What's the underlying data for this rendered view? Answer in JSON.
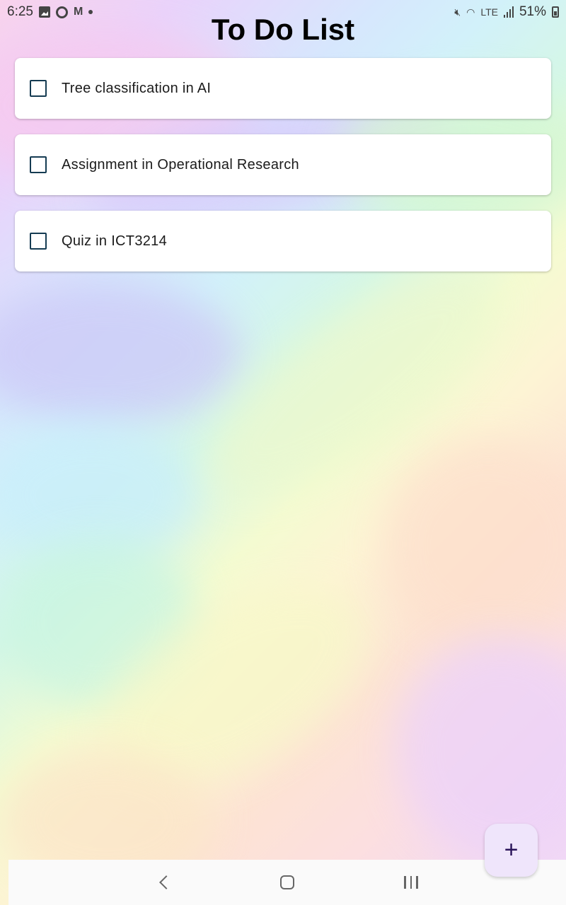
{
  "status_bar": {
    "time": "6:25",
    "battery_percent": "51%",
    "network": "LTE",
    "icons_left": [
      "gallery-icon",
      "sync-icon",
      "gmail-icon",
      "notification-dot-icon"
    ],
    "icons_right": [
      "mute-icon",
      "wifi-icon",
      "volte-icon",
      "signal-icon",
      "battery-icon"
    ]
  },
  "page": {
    "title": "To Do List"
  },
  "todos": [
    {
      "text": "Tree classification in AI",
      "checked": false
    },
    {
      "text": "Assignment in Operational Research",
      "checked": false
    },
    {
      "text": "Quiz in ICT3214",
      "checked": false
    }
  ],
  "fab": {
    "icon": "plus-icon",
    "label": "+"
  },
  "nav_bar": {
    "buttons": [
      "back-icon",
      "home-icon",
      "recents-icon"
    ]
  },
  "colors": {
    "checkbox_border": "#153b52",
    "fab_background": "#efe5fb",
    "fab_icon": "#2a1459"
  }
}
